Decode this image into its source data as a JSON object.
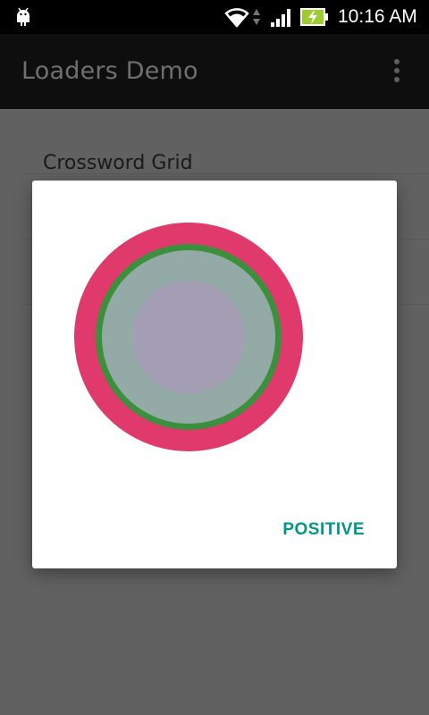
{
  "status_bar": {
    "time": "10:16 AM",
    "icons": [
      "android-debug-icon",
      "wifi-icon",
      "data-arrows-icon",
      "cell-signal-icon",
      "battery-charging-icon"
    ]
  },
  "app_bar": {
    "title": "Loaders Demo",
    "overflow_icon": "overflow-menu-icon"
  },
  "list": {
    "items": [
      {
        "label": "Crossword Grid"
      },
      {
        "label": ""
      },
      {
        "label": ""
      }
    ]
  },
  "dialog": {
    "positive_label": "POSITIVE",
    "loader_icon": "circle-loader",
    "colors": {
      "outer_ring": "#e03a6c",
      "middle_ring": "#3c8f3c",
      "inner_fill": "#93aaa6",
      "center": "#a59fb5",
      "positive_text": "#009688"
    }
  }
}
